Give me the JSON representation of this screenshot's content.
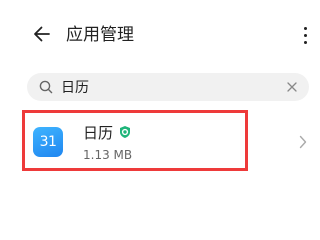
{
  "header": {
    "back_icon": "arrow-left-icon",
    "title": "应用管理",
    "more_icon": "more-vertical-icon"
  },
  "search": {
    "icon": "search-icon",
    "value": "日历",
    "placeholder": "",
    "clear_icon": "close-icon"
  },
  "results": [
    {
      "icon": "calendar-app-icon",
      "icon_text": "31",
      "name": "日历",
      "badge_icon": "verified-shield-icon",
      "size": "1.13 MB",
      "chevron_icon": "chevron-right-icon",
      "highlighted": true
    }
  ],
  "colors": {
    "highlight": "#ee3a3a",
    "app_icon": "#2a9af5",
    "badge": "#1fb57a"
  }
}
